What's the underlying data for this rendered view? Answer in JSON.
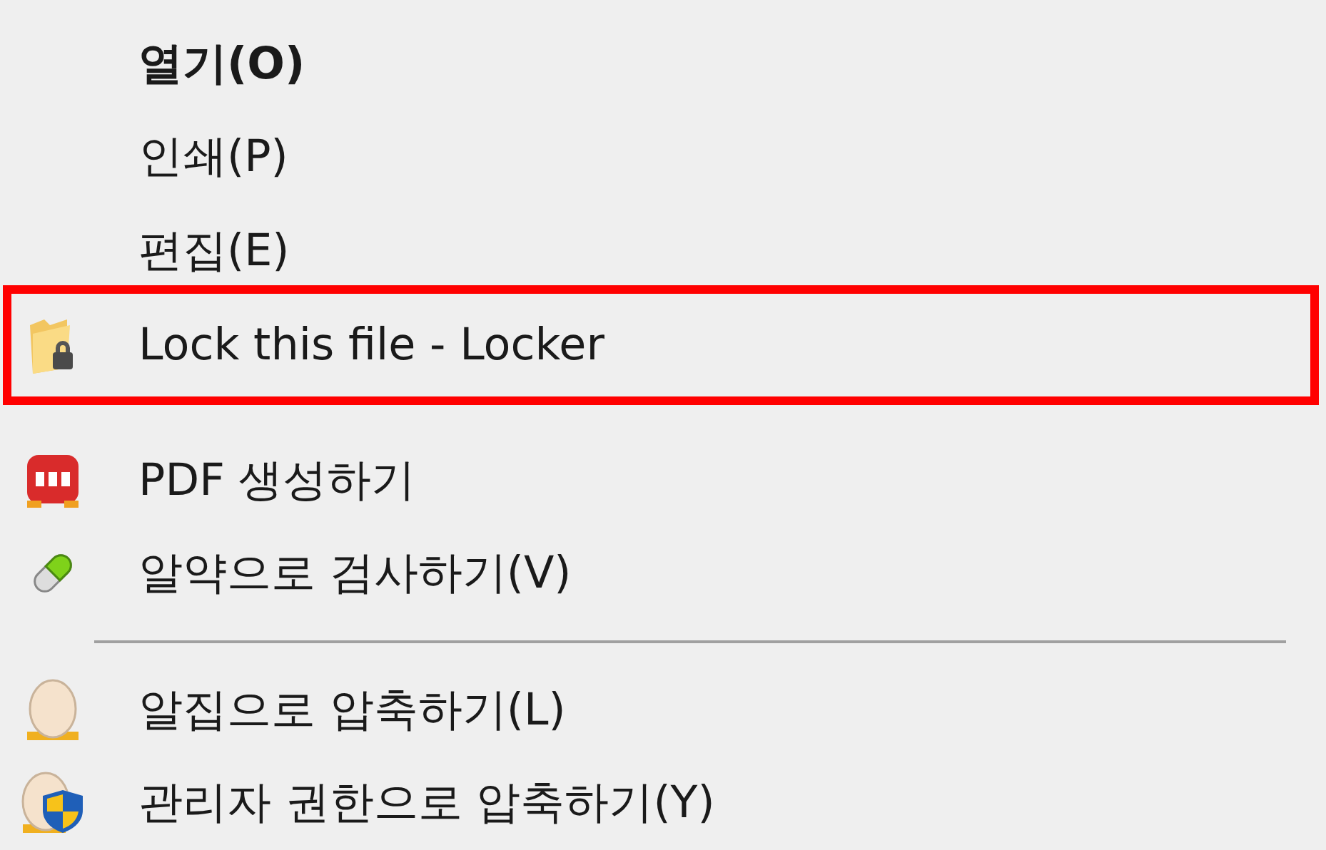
{
  "menu": {
    "items": [
      {
        "kind": "item",
        "label": "열기(O)",
        "default": true,
        "highlighted": false
      },
      {
        "kind": "item",
        "label": "인쇄(P)",
        "default": false,
        "highlighted": false
      },
      {
        "kind": "item",
        "label": "편집(E)",
        "default": false,
        "highlighted": false
      },
      {
        "kind": "item",
        "label": "Lock this file - Locker",
        "default": false,
        "highlighted": true
      },
      {
        "kind": "item",
        "label": "PDF 생성하기",
        "default": false,
        "highlighted": false
      },
      {
        "kind": "item",
        "label": "알약으로 검사하기(V)",
        "default": false,
        "highlighted": false
      },
      {
        "kind": "separator"
      },
      {
        "kind": "item",
        "label": "알집으로 압축하기(L)",
        "default": false,
        "highlighted": false
      },
      {
        "kind": "item",
        "label": "관리자 권한으로 압축하기(Y)",
        "default": false,
        "highlighted": false
      }
    ]
  }
}
